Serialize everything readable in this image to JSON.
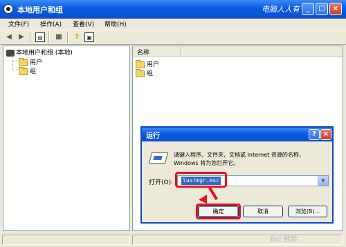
{
  "window": {
    "title": "本地用户和组",
    "watermark": "电脑人人有",
    "controls": [
      "_",
      "□",
      "×"
    ]
  },
  "menu": [
    "文件(F)",
    "操作(A)",
    "查看(V)",
    "帮助(H)"
  ],
  "tree": {
    "root": "本地用户和组 (本地)",
    "items": [
      "用户",
      "组"
    ]
  },
  "list": {
    "column": "名称",
    "items": [
      "用户",
      "组"
    ]
  },
  "run_dialog": {
    "title": "运行",
    "help": "?",
    "close": "×",
    "description": "请键入程序、文件夹、文档或 Internet 资源的名称，Windows 将为您打开它。",
    "open_label": "打开(O):",
    "open_value": "lusrmgr.msc",
    "ok_label": "确定",
    "cancel_label": "取消",
    "browse_label": "浏览(B)..."
  },
  "bottom_watermark": "Bai 经验",
  "colors": {
    "titlebar": "#0a5be0",
    "highlight": "#e8101a",
    "selection": "#316ac5"
  }
}
